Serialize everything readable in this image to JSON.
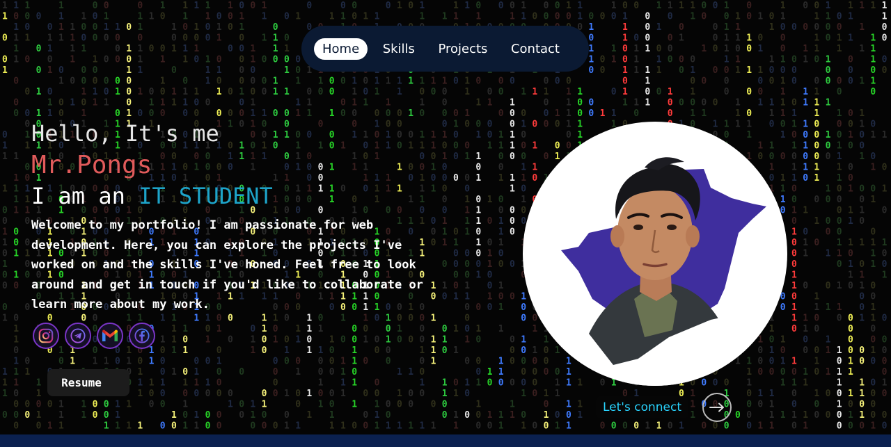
{
  "nav": {
    "items": [
      {
        "label": "Home",
        "active": true
      },
      {
        "label": "Skills",
        "active": false
      },
      {
        "label": "Projects",
        "active": false
      },
      {
        "label": "Contact",
        "active": false
      }
    ]
  },
  "hero": {
    "greeting": "Hello, It's me",
    "name": "Mr.Pongs",
    "role_prefix": "I am an ",
    "role_highlight": "IT STUDENT",
    "intro": "Welcome to my portfolio! I am passionate for web development. Here, you can explore the projects I've worked on and the skills I've honed. Feel free to look around and get in touch if you'd like to collaborate or learn more about my work."
  },
  "socials": [
    {
      "icon": "instagram-icon"
    },
    {
      "icon": "telegram-icon"
    },
    {
      "icon": "gmail-icon"
    },
    {
      "icon": "facebook-icon"
    }
  ],
  "resume": {
    "label": "Resume"
  },
  "connect": {
    "label": "Let's connect",
    "icon": "arrow-right-icon"
  },
  "colors": {
    "background": "#050505",
    "nav_bg": "#0b1a33",
    "name": "#e15b5b",
    "highlight": "#1da4c9",
    "connect": "#29d4ff",
    "portrait_splash": "#3f2e9e",
    "bottom_bar": "#0b2150"
  }
}
